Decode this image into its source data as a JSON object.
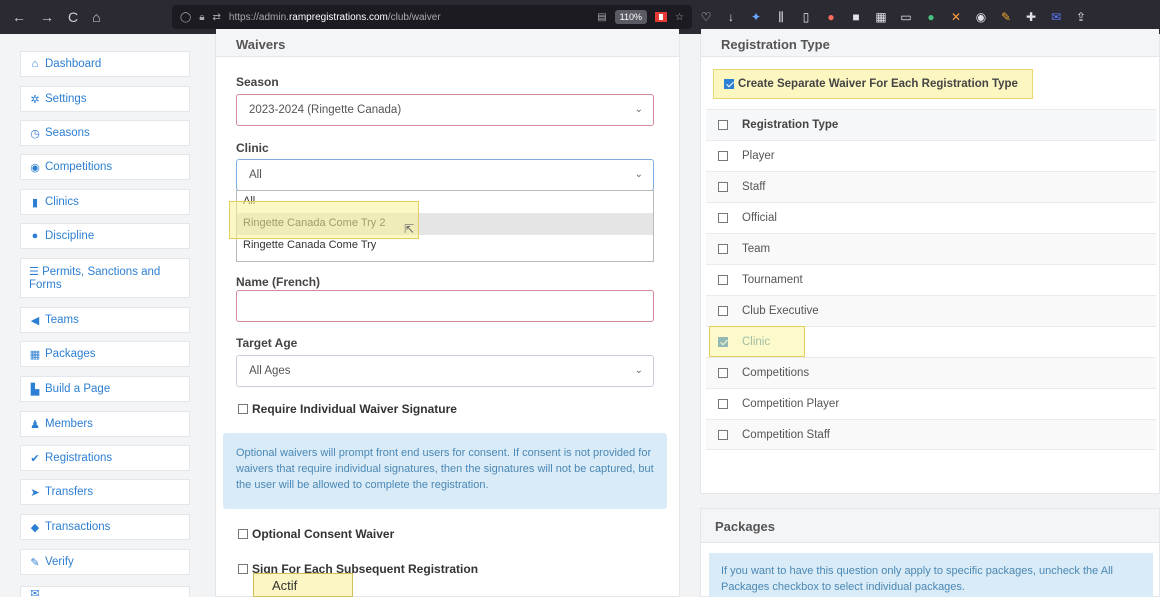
{
  "browser": {
    "url_prefix": "https://admin.",
    "url_domain": "rampregistrations.com",
    "url_path": "/club/waiver",
    "zoom": "110%"
  },
  "sidebar": {
    "items": [
      {
        "label": "Dashboard",
        "icon": "home-icon"
      },
      {
        "label": "Settings",
        "icon": "gear-icon"
      },
      {
        "label": "Seasons",
        "icon": "clock-icon"
      },
      {
        "label": "Competitions",
        "icon": "globe-icon"
      },
      {
        "label": "Clinics",
        "icon": "book-icon"
      },
      {
        "label": "Discipline",
        "icon": "alert-icon"
      },
      {
        "label": "Permits, Sanctions and",
        "label2": "Forms",
        "icon": "list-icon"
      },
      {
        "label": "Teams",
        "icon": "megaphone-icon"
      },
      {
        "label": "Packages",
        "icon": "grid-icon"
      },
      {
        "label": "Build a Page",
        "icon": "file-icon"
      },
      {
        "label": "Members",
        "icon": "user-icon"
      },
      {
        "label": "Registrations",
        "icon": "check-icon"
      },
      {
        "label": "Transfers",
        "icon": "plane-icon"
      },
      {
        "label": "Transactions",
        "icon": "tag-icon"
      },
      {
        "label": "Verify",
        "icon": "pencil-icon"
      }
    ]
  },
  "waivers": {
    "title": "Waivers",
    "season_label": "Season",
    "season_value": "2023-2024 (Ringette Canada)",
    "clinic_label": "Clinic",
    "clinic_value": "All",
    "clinic_options": [
      "All",
      "Ringette Canada Come Try 2",
      "Ringette Canada Come Try"
    ],
    "name_fr_label": "Name (French)",
    "target_age_label": "Target Age",
    "target_age_value": "All Ages",
    "require_sig_label": "Require Individual Waiver Signature",
    "info_text": "Optional waivers will prompt front end users for consent. If consent is not provided for waivers that require individual signatures, then the signatures will not be captured, but the user will be allowed to complete the registration.",
    "optional_consent_label": "Optional Consent Waiver",
    "sign_each_label": "Sign For Each Subsequent Registration",
    "tooltip": "Actif"
  },
  "registration_type": {
    "title": "Registration Type",
    "separate_label": "Create Separate Waiver For Each Registration Type",
    "header": "Registration Type",
    "rows": [
      {
        "label": "Player",
        "checked": false
      },
      {
        "label": "Staff",
        "checked": false
      },
      {
        "label": "Official",
        "checked": false
      },
      {
        "label": "Team",
        "checked": false
      },
      {
        "label": "Tournament",
        "checked": false
      },
      {
        "label": "Club Executive",
        "checked": false
      },
      {
        "label": "Clinic",
        "checked": true
      },
      {
        "label": "Competitions",
        "checked": false
      },
      {
        "label": "Competition Player",
        "checked": false
      },
      {
        "label": "Competition Staff",
        "checked": false
      }
    ]
  },
  "packages": {
    "title": "Packages",
    "info_text": "If you want to have this question only apply to specific packages, uncheck the All Packages checkbox to select individual packages."
  }
}
